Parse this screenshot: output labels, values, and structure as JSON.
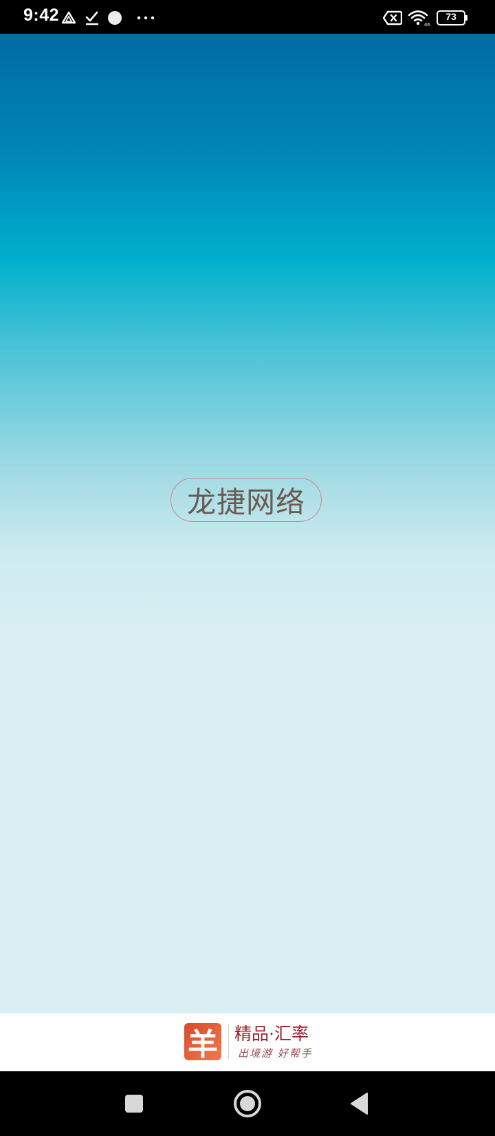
{
  "status_bar": {
    "time": "9:42",
    "left_icons": [
      "drive-icon",
      "checkmark-icon",
      "circle-icon",
      "more-dots-icon"
    ],
    "battery_level": "73",
    "right_icons": [
      "sim-x-icon",
      "wifi-icon",
      "battery-icon"
    ]
  },
  "splash": {
    "brand_text": "龙捷网络",
    "gradient_top": "#006ba3",
    "gradient_mid": "#00b0cc",
    "gradient_bottom": "#d9eff3"
  },
  "footer": {
    "logo_glyph": "羊",
    "title": "精品·汇率",
    "subtitle": "出境游 好帮手",
    "logo_color": "#e05a35",
    "title_color": "#9a1f2a"
  },
  "nav_bar": {
    "buttons": [
      "recents-square-icon",
      "home-circle-icon",
      "back-triangle-icon"
    ]
  }
}
